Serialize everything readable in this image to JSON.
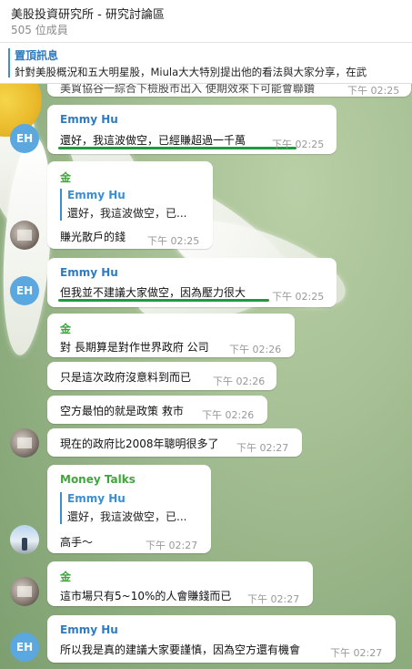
{
  "header": {
    "title": "美股投資研究所 - 研究討論區",
    "members": "505 位成員"
  },
  "pinned": {
    "title": "置頂訊息",
    "text": "針對美股概況和五大明星股，Miula大大特別提出他的看法與大家分享，在武"
  },
  "partial_message": {
    "text": "美貿協谷一綜合下檢股市出入 使期效來下可能會聯鑽",
    "time": "下午 02:25"
  },
  "messages": [
    {
      "sender": "Emmy Hu",
      "avatar_text": "EH",
      "text": "還好，我這波做空，已經賺超過一千萬",
      "time": "下午 02:25"
    },
    {
      "sender": "金",
      "reply_name": "Emmy Hu",
      "reply_text": "還好，我這波做空，已...",
      "text": "賺光散戶的錢",
      "time": "下午 02:25"
    },
    {
      "sender": "Emmy Hu",
      "avatar_text": "EH",
      "text": "但我並不建議大家做空，因為壓力很大",
      "time": "下午 02:25"
    },
    {
      "sender": "金",
      "text": "對 長期算是對作世界政府 公司",
      "time": "下午 02:26"
    },
    {
      "text": "只是這次政府沒意料到而已",
      "time": "下午 02:26"
    },
    {
      "text": "空方最怕的就是政策 救市",
      "time": "下午 02:26"
    },
    {
      "text": "現在的政府比2008年聰明很多了",
      "time": "下午 02:27"
    },
    {
      "sender": "Money Talks",
      "reply_name": "Emmy Hu",
      "reply_text": "還好，我這波做空，已...",
      "text": "高手～",
      "time": "下午 02:27"
    },
    {
      "sender": "金",
      "text": "這市場只有5~10%的人會賺錢而已",
      "time": "下午 02:27"
    },
    {
      "sender": "Emmy Hu",
      "avatar_text": "EH",
      "text": "所以我是真的建議大家要謹慎，因為空方還有機會",
      "time": "下午 02:27"
    }
  ],
  "colors": {
    "emmy_name": "#2f7bbf",
    "jin_name": "#3fa63a",
    "money_name": "#3fa63a",
    "link_accent": "#3a8fd4",
    "underline": "#1f9a3c",
    "avatar_eh_bg": "#5ba7e0"
  }
}
